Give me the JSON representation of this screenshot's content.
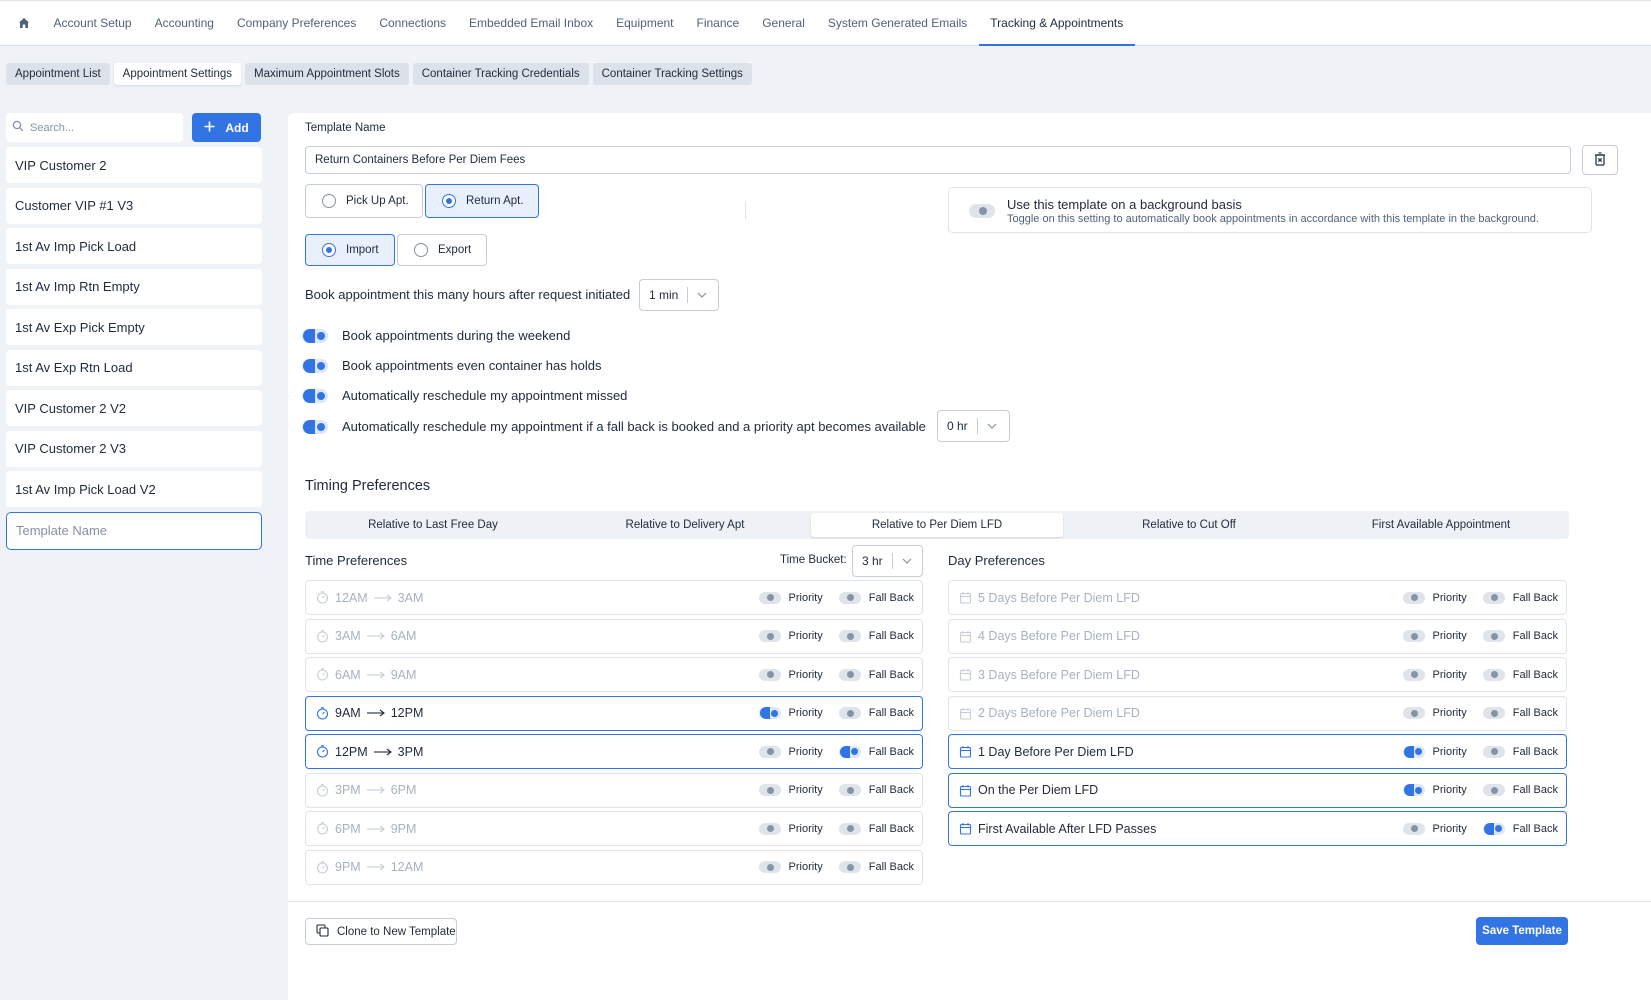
{
  "topnav": {
    "tabs": [
      "Account Setup",
      "Accounting",
      "Company Preferences",
      "Connections",
      "Embedded Email Inbox",
      "Equipment",
      "Finance",
      "General",
      "System Generated Emails",
      "Tracking & Appointments"
    ],
    "active_index": 9
  },
  "subtabs": {
    "items": [
      "Appointment List",
      "Appointment Settings",
      "Maximum Appointment Slots",
      "Container Tracking Credentials",
      "Container Tracking Settings"
    ],
    "active_index": 1
  },
  "sidebar": {
    "search_placeholder": "Search...",
    "add_label": "Add",
    "items": [
      "VIP Customer 2",
      "Customer VIP #1 V3",
      "1st Av Imp Pick Load",
      "1st Av Imp Rtn Empty",
      "1st Av Exp Pick Empty",
      "1st Av Exp Rtn Load",
      "VIP Customer 2 V2",
      "VIP Customer 2 V3",
      "1st Av Imp Pick Load V2"
    ],
    "new_placeholder": "Template Name"
  },
  "form": {
    "template_name_label": "Template Name",
    "template_name_value": "Return Containers Before Per Diem Fees",
    "apt_type": {
      "options": [
        "Pick Up Apt.",
        "Return Apt."
      ],
      "selected": "Return Apt."
    },
    "move_type": {
      "options": [
        "Import",
        "Export"
      ],
      "selected": "Import"
    },
    "background": {
      "title": "Use this template on a background basis",
      "subtitle": "Toggle on this setting to automatically book appointments in accordance with this template in the background.",
      "enabled": false
    },
    "hours_after_label": "Book appointment this many hours after request initiated",
    "hours_after_value": "1 min",
    "options": [
      {
        "label": "Book appointments during the weekend",
        "enabled": true
      },
      {
        "label": "Book appointments even container has holds",
        "enabled": true
      },
      {
        "label": "Automatically reschedule my appointment missed",
        "enabled": true
      },
      {
        "label": "Automatically reschedule my appointment if a fall back is booked and a priority apt becomes available",
        "enabled": true
      }
    ],
    "reschedule_value": "0 hr"
  },
  "timing": {
    "title": "Timing Preferences",
    "tabs": [
      "Relative to Last Free Day",
      "Relative to Delivery Apt",
      "Relative to Per Diem LFD",
      "Relative to Cut Off",
      "First Available Appointment"
    ],
    "active_index": 2,
    "time_title": "Time Preferences",
    "bucket_label": "Time Bucket:",
    "bucket_value": "3 hr",
    "priority_label": "Priority",
    "fallback_label": "Fall Back",
    "time_rows": [
      {
        "from": "12AM",
        "to": "3AM",
        "priority": false,
        "fallback": false
      },
      {
        "from": "3AM",
        "to": "6AM",
        "priority": false,
        "fallback": false
      },
      {
        "from": "6AM",
        "to": "9AM",
        "priority": false,
        "fallback": false
      },
      {
        "from": "9AM",
        "to": "12PM",
        "priority": true,
        "fallback": false
      },
      {
        "from": "12PM",
        "to": "3PM",
        "priority": false,
        "fallback": true
      },
      {
        "from": "3PM",
        "to": "6PM",
        "priority": false,
        "fallback": false
      },
      {
        "from": "6PM",
        "to": "9PM",
        "priority": false,
        "fallback": false
      },
      {
        "from": "9PM",
        "to": "12AM",
        "priority": false,
        "fallback": false
      }
    ],
    "day_title": "Day Preferences",
    "day_rows": [
      {
        "label": "5 Days Before Per Diem LFD",
        "priority": false,
        "fallback": false
      },
      {
        "label": "4 Days Before Per Diem LFD",
        "priority": false,
        "fallback": false
      },
      {
        "label": "3 Days Before Per Diem LFD",
        "priority": false,
        "fallback": false
      },
      {
        "label": "2 Days Before Per Diem LFD",
        "priority": false,
        "fallback": false
      },
      {
        "label": "1 Day Before Per Diem LFD",
        "priority": true,
        "fallback": false
      },
      {
        "label": "On the Per Diem LFD",
        "priority": true,
        "fallback": false
      },
      {
        "label": "First Available After LFD Passes",
        "priority": false,
        "fallback": true
      }
    ]
  },
  "footer": {
    "clone_label": "Clone to New Template",
    "save_label": "Save Template"
  },
  "colors": {
    "accent": "#3374e4",
    "background": "#eff3f8",
    "panel": "#ffffff"
  }
}
